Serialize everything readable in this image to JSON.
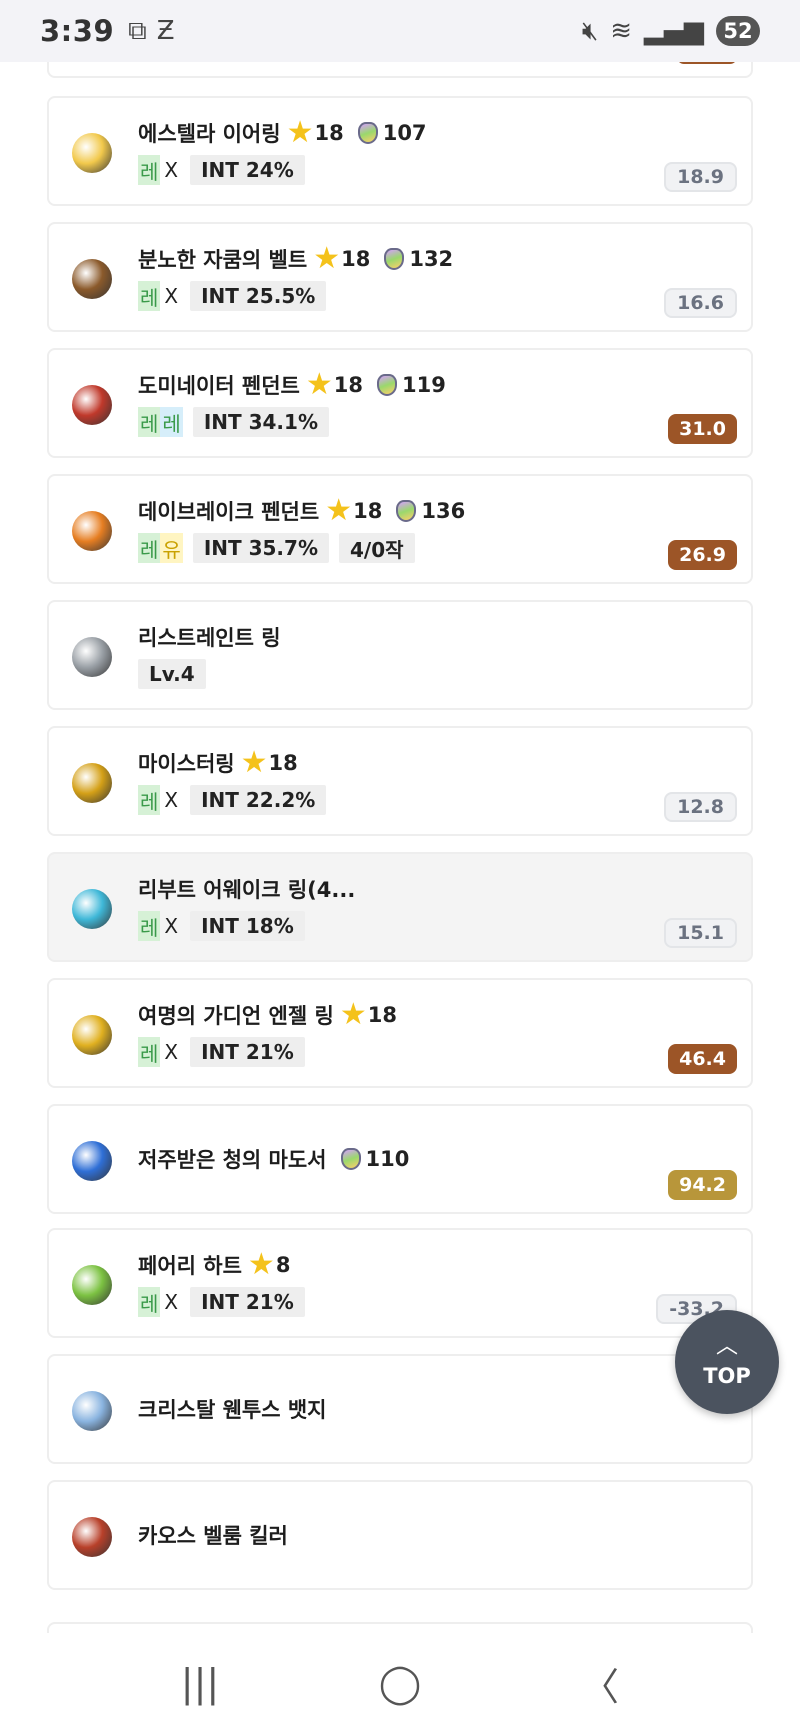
{
  "status_bar": {
    "time": "3:39",
    "battery": "52"
  },
  "items": [
    {
      "name": "",
      "partial": "top",
      "score": "",
      "score_style": "brown"
    },
    {
      "name": "에스텔라 이어링",
      "stars": "18",
      "gem": "107",
      "pot_a": "레",
      "pot_b": "X",
      "pot_style": "legend-x",
      "stats": [
        "INT 24%"
      ],
      "score": "18.9",
      "score_style": "gray",
      "icon_color": "#f2c94c"
    },
    {
      "name": "분노한 자쿰의 벨트",
      "stars": "18",
      "gem": "132",
      "pot_a": "레",
      "pot_b": "X",
      "pot_style": "legend-x",
      "stats": [
        "INT 25.5%"
      ],
      "score": "16.6",
      "score_style": "gray",
      "icon_color": "#8b5a2b"
    },
    {
      "name": "도미네이터 펜던트",
      "stars": "18",
      "gem": "119",
      "pot_a": "레",
      "pot_b": "레",
      "pot_style": "legend-legend",
      "stats": [
        "INT 34.1%"
      ],
      "score": "31.0",
      "score_style": "brown",
      "icon_color": "#c0392b"
    },
    {
      "name": "데이브레이크 펜던트",
      "stars": "18",
      "gem": "136",
      "pot_a": "레",
      "pot_b": "유",
      "pot_style": "legend-unique",
      "stats": [
        "INT 35.7%",
        "4/0작"
      ],
      "score": "26.9",
      "score_style": "brown",
      "icon_color": "#e67e22"
    },
    {
      "name": "리스트레인트 링",
      "stats": [
        "Lv.4"
      ],
      "pot_style": "none",
      "score": "",
      "icon_color": "#9aa0a6"
    },
    {
      "name": "마이스터링",
      "stars": "18",
      "pot_a": "레",
      "pot_b": "X",
      "pot_style": "legend-x",
      "stats": [
        "INT 22.2%"
      ],
      "score": "12.8",
      "score_style": "gray",
      "icon_color": "#d4a017"
    },
    {
      "name": "리부트 어웨이크 링(4...",
      "pot_a": "레",
      "pot_b": "X",
      "pot_style": "legend-x",
      "stats": [
        "INT 18%"
      ],
      "score": "15.1",
      "score_style": "gray",
      "icon_color": "#3fb8d8",
      "highlight": true
    },
    {
      "name": "여명의 가디언 엔젤 링",
      "stars": "18",
      "pot_a": "레",
      "pot_b": "X",
      "pot_style": "legend-x",
      "stats": [
        "INT 21%"
      ],
      "score": "46.4",
      "score_style": "brown",
      "icon_color": "#e0b020"
    },
    {
      "name": "저주받은 청의 마도서",
      "gem": "110",
      "pot_style": "none",
      "stats": [],
      "score": "94.2",
      "score_style": "gold",
      "icon_color": "#2f6fd6",
      "center_title": true
    },
    {
      "name": "페어리 하트",
      "stars": "8",
      "pot_a": "레",
      "pot_b": "X",
      "pot_style": "legend-x",
      "stats": [
        "INT 21%"
      ],
      "score": "-33.2",
      "score_style": "gray",
      "icon_color": "#7cc242"
    },
    {
      "name": "크리스탈 웬투스 뱃지",
      "pot_style": "none",
      "stats": [],
      "score": "",
      "icon_color": "#8ab4e0",
      "center_title": true
    },
    {
      "name": "카오스 벨룸 킬러",
      "pot_style": "none",
      "stats": [],
      "score": "",
      "icon_color": "#b8402a",
      "center_title": true
    },
    {
      "name": "",
      "partial": "bottom",
      "score": ""
    }
  ],
  "top_button": {
    "label": "TOP"
  },
  "nav": {
    "recents": "|||",
    "home": "◯",
    "back": "〈"
  }
}
